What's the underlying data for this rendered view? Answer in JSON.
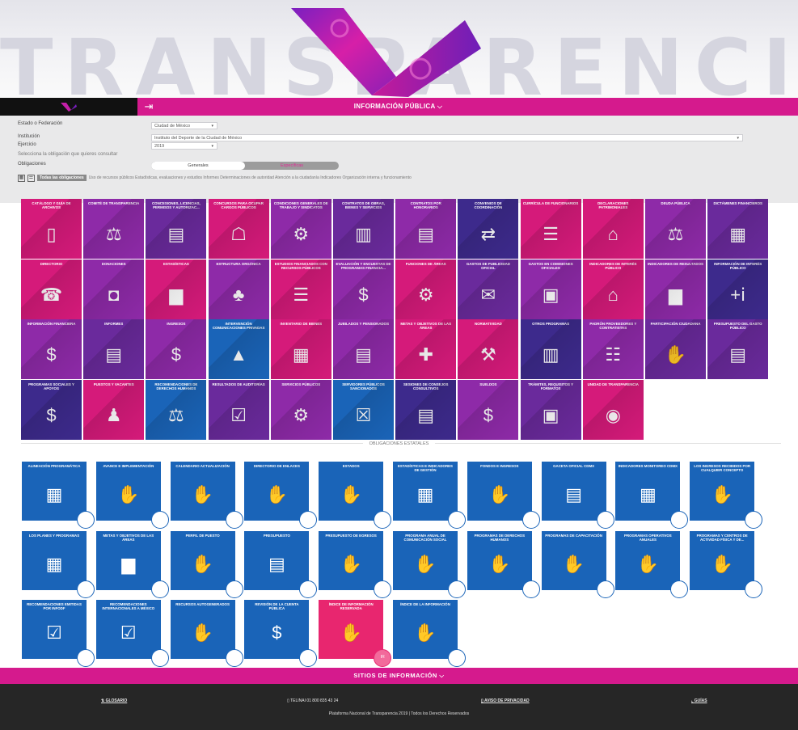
{
  "hero": {
    "word": "TRANSPARENCIA"
  },
  "navbar": {
    "title": "INFORMACIÓN PÚBLICA",
    "chevron": "⌵",
    "icon": "login-icon"
  },
  "filters": {
    "state_label": "Estado o Federación",
    "state_value": "Ciudad de México",
    "institution_label": "Institución",
    "institution_value": "Instituto del Deporte de la Ciudad de México",
    "year_label": "Ejercicio",
    "year_value": "2019",
    "instruction": "Selecciona la obligación que quieres consultar",
    "obligations_label": "Obligaciones",
    "tab_general": "Generales",
    "tab_specific": "Específicas",
    "all_tag": "Todas las obligaciones",
    "quick_links": "Uso de recursos públicos Estadísticas, evaluaciones y estudios Informes Determinaciones de autoridad Atención a la ciudadanía Indicadores Organización interna y funcionamiento"
  },
  "tiles": [
    {
      "label": "Catálogo y guía de archivos",
      "icon": "▯",
      "color": "#d51a7a"
    },
    {
      "label": "Comité de transparencia",
      "icon": "⚖",
      "color": "#8e2aa8"
    },
    {
      "label": "Concesiones, licencias, permisos y autorizac...",
      "icon": "▤",
      "color": "#6a2a9c"
    },
    {
      "label": "Concursos para ocupar cargos públicos",
      "icon": "☖",
      "color": "#d51a7a"
    },
    {
      "label": "Condiciones generales de trabajo y sindicatos",
      "icon": "⚙",
      "color": "#8e2aa8"
    },
    {
      "label": "Contratos de obras, bienes y servicios",
      "icon": "▥",
      "color": "#6a2a9c"
    },
    {
      "label": "Contratos por honorarios",
      "icon": "▤",
      "color": "#8e2aa8"
    },
    {
      "label": "Convenios de coordinación",
      "icon": "⇄",
      "color": "#3d2a8c"
    },
    {
      "label": "Currícula de funcionarios",
      "icon": "☰",
      "color": "#d51a7a"
    },
    {
      "label": "Declaraciones patrimoniales",
      "icon": "⌂",
      "color": "#d51a7a"
    },
    {
      "label": "Deuda pública",
      "icon": "⚖",
      "color": "#8e2aa8"
    },
    {
      "label": "Dictámenes financieros",
      "icon": "▦",
      "color": "#6a2a9c"
    },
    {
      "label": "Directorio",
      "icon": "☎",
      "color": "#d51a7a"
    },
    {
      "label": "Donaciones",
      "icon": "◘",
      "color": "#8e2aa8"
    },
    {
      "label": "Estadísticas",
      "icon": "▆",
      "color": "#d51a7a"
    },
    {
      "label": "Estructura orgánica",
      "icon": "♣",
      "color": "#8e2aa8"
    },
    {
      "label": "Estudios financiados con recursos públicos",
      "icon": "☰",
      "color": "#d51a7a"
    },
    {
      "label": "Evaluación y encuestas de programas financia...",
      "icon": "$",
      "color": "#8e2aa8"
    },
    {
      "label": "Funciones de áreas",
      "icon": "⚙",
      "color": "#d51a7a"
    },
    {
      "label": "Gastos de publicidad oficial",
      "icon": "✉",
      "color": "#6a2a9c"
    },
    {
      "label": "Gastos en comisiones oficiales",
      "icon": "▣",
      "color": "#8e2aa8"
    },
    {
      "label": "Indicadores de interés público",
      "icon": "⌂",
      "color": "#d51a7a"
    },
    {
      "label": "Indicadores de resultados",
      "icon": "▆",
      "color": "#8e2aa8"
    },
    {
      "label": "Información de interés público",
      "icon": "+ⅰ",
      "color": "#3d2a8c"
    },
    {
      "label": "Información financiera",
      "icon": "$",
      "color": "#8e2aa8"
    },
    {
      "label": "Informes",
      "icon": "▤",
      "color": "#6a2a9c"
    },
    {
      "label": "Ingresos",
      "icon": "$",
      "color": "#8e2aa8"
    },
    {
      "label": "Intervención comunicaciones privadas",
      "icon": "▲",
      "color": "#1a64b8"
    },
    {
      "label": "Inventario de bienes",
      "icon": "▦",
      "color": "#d51a7a"
    },
    {
      "label": "Jubilados y pensionados",
      "icon": "▤",
      "color": "#8e2aa8"
    },
    {
      "label": "Metas y objetivos de las áreas",
      "icon": "✚",
      "color": "#d51a7a"
    },
    {
      "label": "Normatividad",
      "icon": "⚒",
      "color": "#d51a7a"
    },
    {
      "label": "Otros programas",
      "icon": "▥",
      "color": "#3d2a8c"
    },
    {
      "label": "Padrón proveedores y contratistas",
      "icon": "☷",
      "color": "#8e2aa8"
    },
    {
      "label": "Participación ciudadana",
      "icon": "✋",
      "color": "#6a2a9c"
    },
    {
      "label": "Presupuesto del gasto público",
      "icon": "▤",
      "color": "#6a2a9c"
    },
    {
      "label": "Programas sociales y apoyos",
      "icon": "$",
      "color": "#3d2a8c"
    },
    {
      "label": "Puestos y vacantes",
      "icon": "♟",
      "color": "#d51a7a"
    },
    {
      "label": "Recomendaciones de derechos humanos",
      "icon": "⚖",
      "color": "#1a64b8"
    },
    {
      "label": "Resultados de auditorías",
      "icon": "☑",
      "color": "#6a2a9c"
    },
    {
      "label": "Servicios públicos",
      "icon": "⚙",
      "color": "#8e2aa8"
    },
    {
      "label": "Servidores públicos sancionados",
      "icon": "☒",
      "color": "#1a64b8"
    },
    {
      "label": "Sesiones de consejos consultivos",
      "icon": "▤",
      "color": "#3d2a8c"
    },
    {
      "label": "Sueldos",
      "icon": "$",
      "color": "#8e2aa8"
    },
    {
      "label": "Trámites, requisitos y formatos",
      "icon": "▣",
      "color": "#6a2a9c"
    },
    {
      "label": "Unidad de transparencia",
      "icon": "◉",
      "color": "#d51a7a"
    }
  ],
  "state_section_title": "OBLIGACIONES ESTATALES",
  "state_tiles": [
    {
      "label": "Alineación programática",
      "icon": "▦"
    },
    {
      "label": "Avance e implementación",
      "icon": "✋"
    },
    {
      "label": "Calendario actualización",
      "icon": "✋"
    },
    {
      "label": "Directorio de enlaces",
      "icon": "✋"
    },
    {
      "label": "Estados",
      "icon": "✋"
    },
    {
      "label": "Estadísticas e indicadores de gestión",
      "icon": "▦"
    },
    {
      "label": "Fondos e ingresos",
      "icon": "✋"
    },
    {
      "label": "Gaceta oficial CDMX",
      "icon": "▤"
    },
    {
      "label": "Indicadores monitoreo CDMX",
      "icon": "▦"
    },
    {
      "label": "Los ingresos recibidos por cualquier concepto",
      "icon": "✋"
    },
    {
      "label": "Los planes y programas",
      "icon": "▦"
    },
    {
      "label": "Metas y objetivos de las áreas",
      "icon": "▆"
    },
    {
      "label": "Perfil de puesto",
      "icon": "✋"
    },
    {
      "label": "Presupuesto",
      "icon": "▤"
    },
    {
      "label": "Presupuesto de egresos",
      "icon": "✋"
    },
    {
      "label": "Programa anual de comunicación social",
      "icon": "✋"
    },
    {
      "label": "Programas de derechos humanos",
      "icon": "✋"
    },
    {
      "label": "Programas de capacitación",
      "icon": "✋"
    },
    {
      "label": "Programas operativos anuales",
      "icon": "✋"
    },
    {
      "label": "Programas y centros de actividad física y de...",
      "icon": "✋"
    },
    {
      "label": "Recomendaciones emitidas por INFODF",
      "icon": "☑"
    },
    {
      "label": "Recomendaciones internacionales a México",
      "icon": "☑"
    },
    {
      "label": "Recursos autogenerados",
      "icon": "✋"
    },
    {
      "label": "Revisión de la cuenta pública",
      "icon": "$"
    },
    {
      "label": "Índice de información reservada",
      "icon": "✋",
      "pink": true,
      "badge": "IR"
    },
    {
      "label": "Índice de la información",
      "icon": "✋"
    }
  ],
  "sitios": {
    "label": "SITIOS DE INFORMACIÓN",
    "chevron": "⌵"
  },
  "footer": {
    "glossary": "GLOSARIO",
    "phone": "TELINAI 01 800 835 43 24",
    "privacy": "AVISO DE PRIVACIDAD",
    "guides": "GUÍAS",
    "copyright": "Plataforma Nacional de Transparencia 2019 | Todos los Derechos Reservados"
  }
}
